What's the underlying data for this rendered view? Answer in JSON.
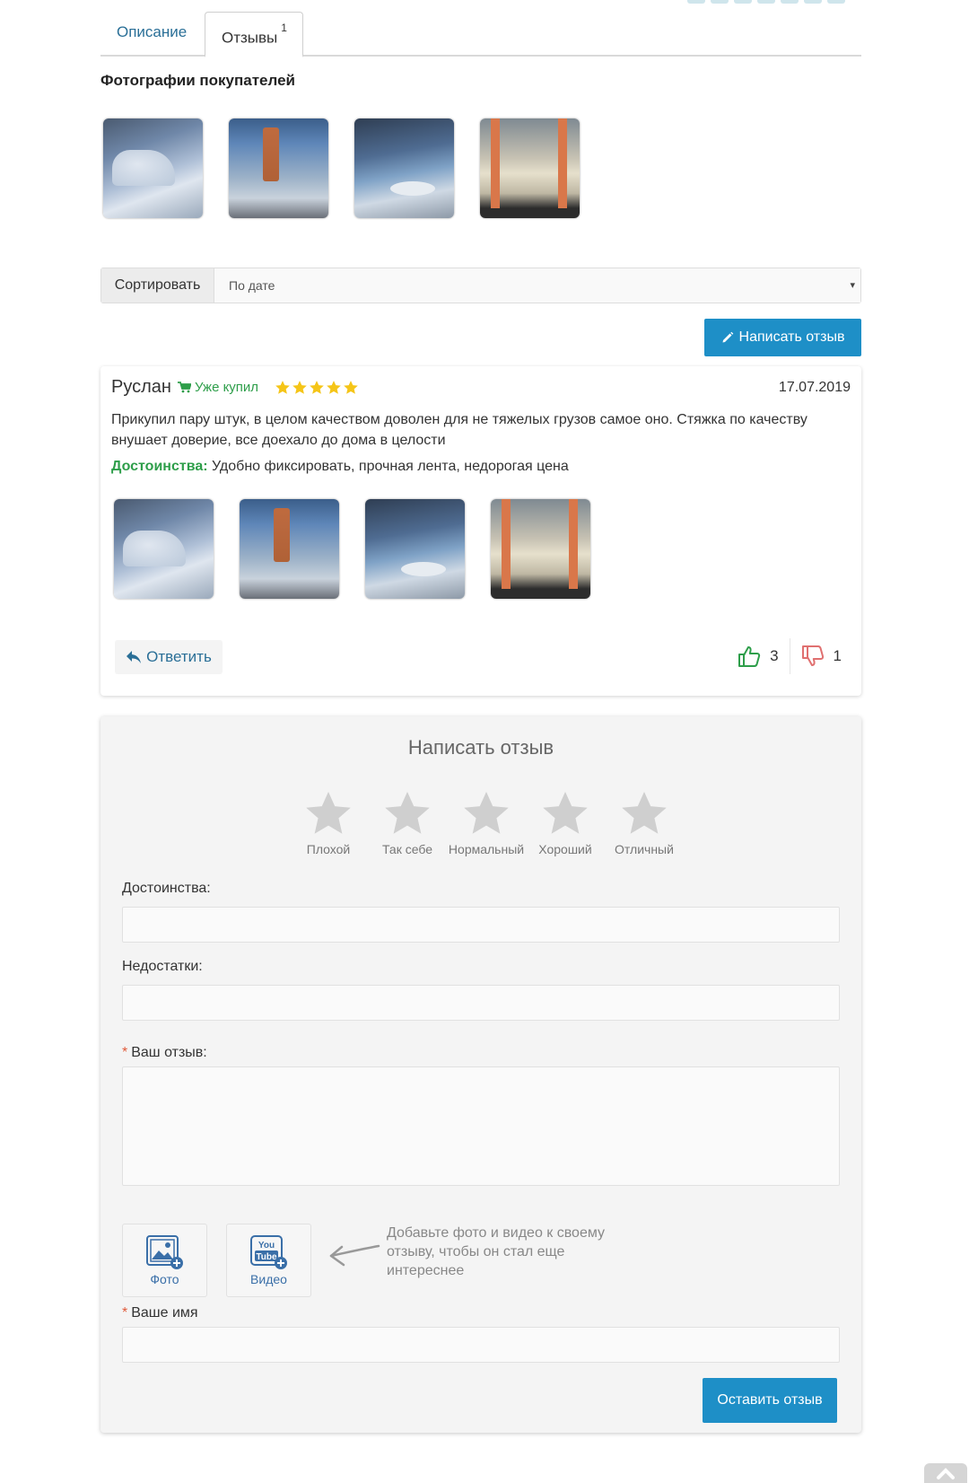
{
  "tabs": [
    {
      "label": "Описание"
    },
    {
      "label": "Отзывы",
      "count": "1"
    }
  ],
  "customer_photos": {
    "title": "Фотографии покупателей",
    "photos": [
      "photo-1",
      "photo-2",
      "photo-3",
      "photo-4"
    ]
  },
  "sort": {
    "label": "Сортировать",
    "selected": "По дате",
    "caret": "▾"
  },
  "write_review_button": "Написать отзыв",
  "review": {
    "author": "Руслан",
    "bought_badge": "Уже купил",
    "rating": 5,
    "date": "17.07.2019",
    "text": "Прикупил пару штук, в целом качеством доволен для не тяжелых грузов самое оно. Стяжка по качеству внушает доверие, все доехало до дома в целости",
    "pros_label": "Достоинства:",
    "pros_text": "Удобно фиксировать, прочная лента, недорогая цена",
    "reply_label": "Ответить",
    "likes": "3",
    "dislikes": "1"
  },
  "form": {
    "title": "Написать отзыв",
    "rating_labels": [
      "Плохой",
      "Так себе",
      "Нормальный",
      "Хороший",
      "Отличный"
    ],
    "pros_label": "Достоинства:",
    "cons_label": "Недостатки:",
    "required_mark": "*",
    "review_label": "Ваш отзыв:",
    "photo_label": "Фото",
    "video_label": "Видео",
    "youtube_text_1": "You",
    "youtube_text_2": "Tube",
    "hint": "Добавьте фото и видео к своему отзыву, чтобы он стал еще интереснее",
    "name_label": "Ваше имя",
    "submit_label": "Оставить отзыв"
  },
  "colors": {
    "accent": "#1e8fc7",
    "link": "#2a6f97",
    "green": "#2e9e4a",
    "star": "#f5c518",
    "dislike": "#e07070"
  }
}
